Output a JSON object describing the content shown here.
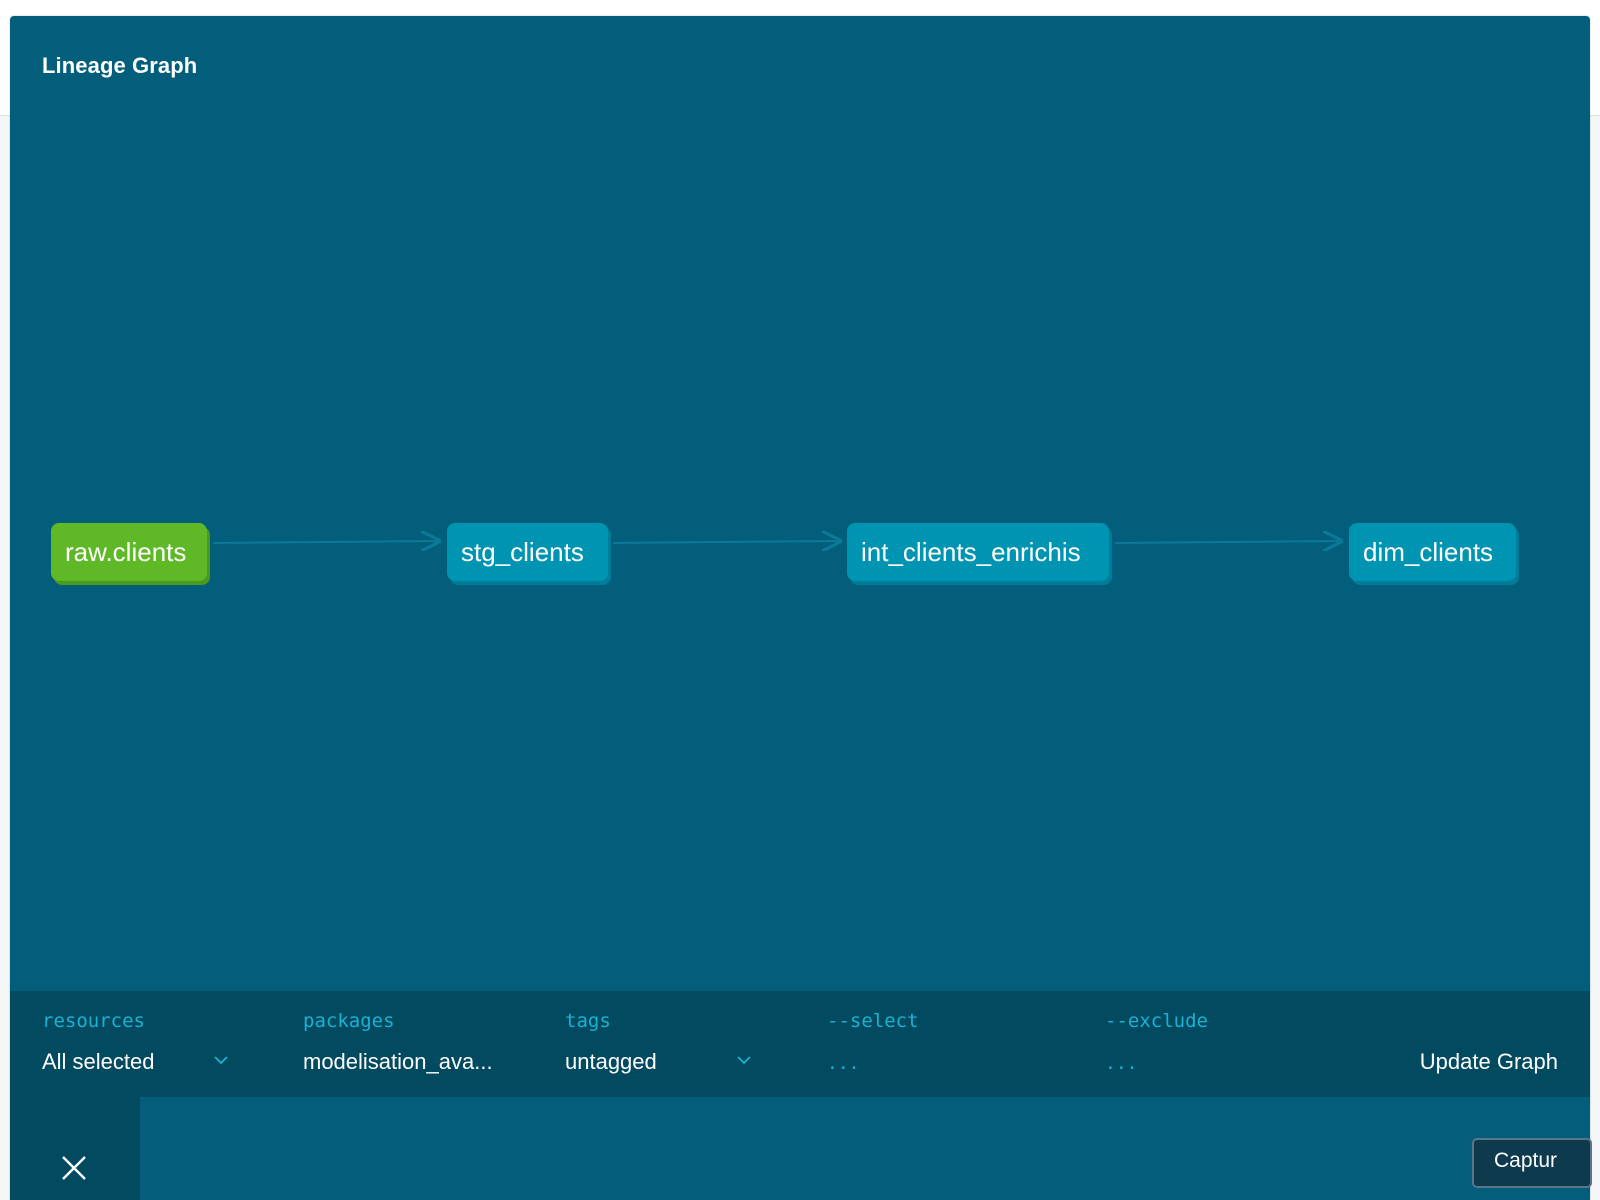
{
  "panel": {
    "title": "Lineage Graph"
  },
  "graph": {
    "nodes": [
      {
        "label": "raw.clients",
        "kind": "source"
      },
      {
        "label": "stg_clients",
        "kind": "model"
      },
      {
        "label": "int_clients_enrichis",
        "kind": "model"
      },
      {
        "label": "dim_clients",
        "kind": "model"
      }
    ]
  },
  "toolbar": {
    "resources": {
      "label": "resources",
      "value": "All selected"
    },
    "packages": {
      "label": "packages",
      "value": "modelisation_ava..."
    },
    "tags": {
      "label": "tags",
      "value": "untagged"
    },
    "select": {
      "label": "--select",
      "value": "..."
    },
    "exclude": {
      "label": "--exclude",
      "value": "..."
    },
    "update_label": "Update Graph"
  },
  "capture": {
    "label": "Captur"
  },
  "colors": {
    "panel_bg": "#025e7a",
    "toolbar_bg": "#014a60",
    "source_node": "#5fb825",
    "model_node": "#0094b3",
    "accent_text": "#1bb2d2"
  },
  "icons": {
    "dropdown": "chevron-down-icon",
    "close": "close-icon"
  }
}
